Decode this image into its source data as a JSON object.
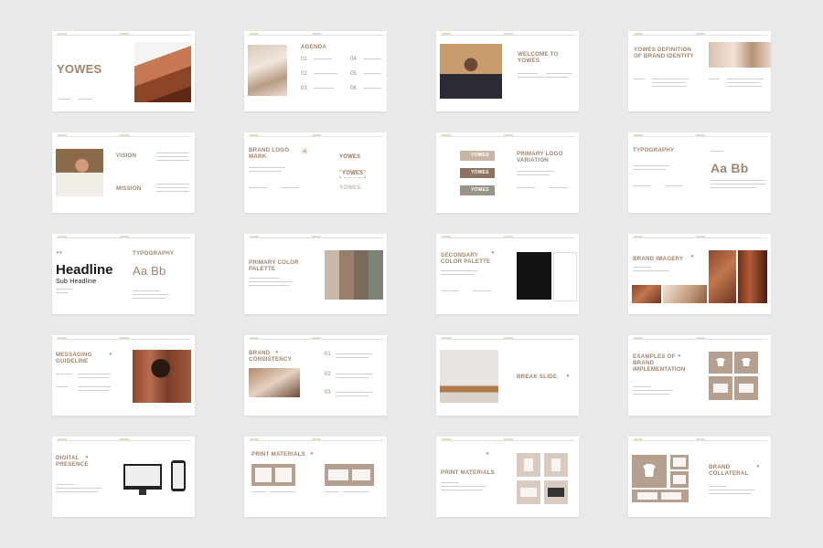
{
  "brand": "YOWES",
  "slides": {
    "s1": {
      "title": "YOWES"
    },
    "s2": {
      "title": "AGENDA",
      "nums": [
        "01",
        "02",
        "03",
        "04",
        "05",
        "06"
      ]
    },
    "s3": {
      "title": "WELCOME TO YOWES"
    },
    "s4": {
      "title": "YOWES DEFINITION OF BRAND IDENTITY"
    },
    "s5": {
      "vision": "VISION",
      "mission": "MISSION"
    },
    "s6": {
      "title": "BRAND LOGO MARK",
      "logos": [
        "YOWES",
        "YOWES",
        "YOWES"
      ]
    },
    "s7": {
      "title": "PRIMARY LOGO VARIATION",
      "logos": [
        "YOWES",
        "YOWES",
        "YOWES"
      ]
    },
    "s8": {
      "title": "TYPOGRAPHY",
      "sample": "Aa  Bb"
    },
    "s9": {
      "headline": "Headline",
      "subheadline": "Sub Headline",
      "title": "TYPOGRAPHY",
      "sample": "Aa  Bb"
    },
    "s10": {
      "title": "PRIMARY COLOR PALETTE"
    },
    "s11": {
      "title": "SECONDARY COLOR PALETTE"
    },
    "s12": {
      "title": "BRAND IMAGERY"
    },
    "s13": {
      "title": "MESSAGING GUIDELINE"
    },
    "s14": {
      "title": "BRAND CONSISTENCY",
      "nums": [
        "01",
        "02",
        "03"
      ]
    },
    "s15": {
      "title": "BREAK SLIDE."
    },
    "s16": {
      "title": "EXAMPLES OF BRAND IMPLEMENTATION"
    },
    "s17": {
      "title": "DIGITAL PRESENCE"
    },
    "s18": {
      "title": "PRINT MATERIALS"
    },
    "s19": {
      "title": "PRINT MATERIALS"
    },
    "s20": {
      "title": "BRAND COLLATERAL"
    }
  },
  "palette": {
    "primary": [
      "#c8b8aa",
      "#9a7e6c",
      "#7a6b5d",
      "#7b8376"
    ],
    "secondary": [
      "#121212",
      "#ffffff"
    ],
    "accent": "#a08570",
    "background": "#e9e9ea"
  }
}
